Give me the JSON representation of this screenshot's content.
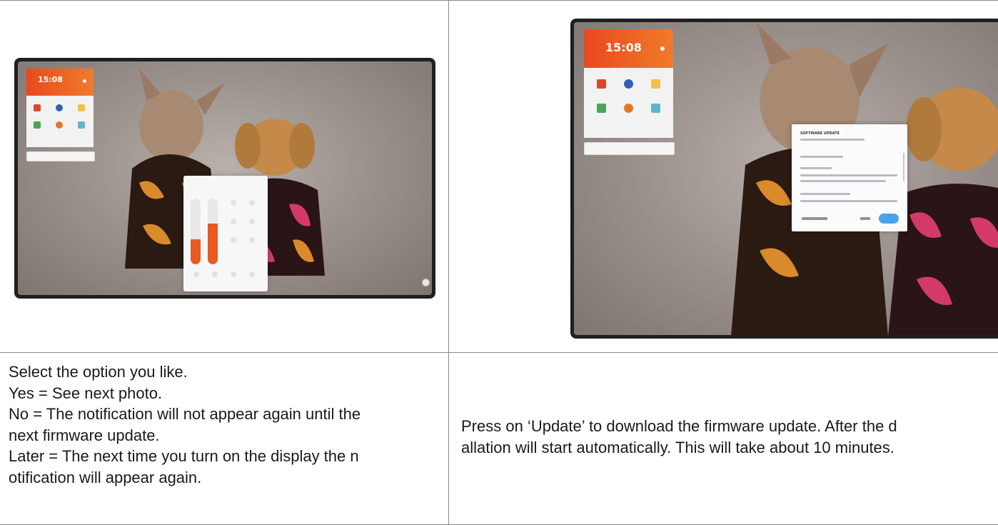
{
  "table": {
    "rows": [
      {
        "left_image": {
          "clock_time": "15:08",
          "dialog_title": ""
        },
        "right_image": {
          "clock_time": "15:08",
          "dialog_title": "SOFTWARE UPDATE"
        }
      },
      {
        "left_text": [
          "Select the option you like.",
          "Yes = See next photo.",
          "No = The notification will not appear again until the",
          "next firmware update.",
          "Later = The next time you turn on the display the n",
          "otification will appear again."
        ],
        "right_text": [
          "Press on ‘Update’ to download the firmware update. After the d",
          "allation will start automatically. This will take about 10  minutes."
        ]
      }
    ]
  },
  "colors": {
    "clock_orange": "#e9491f",
    "slider_orange": "#e85a1f",
    "update_button_blue": "#4aa3e8",
    "table_border": "#8a8a8a"
  }
}
